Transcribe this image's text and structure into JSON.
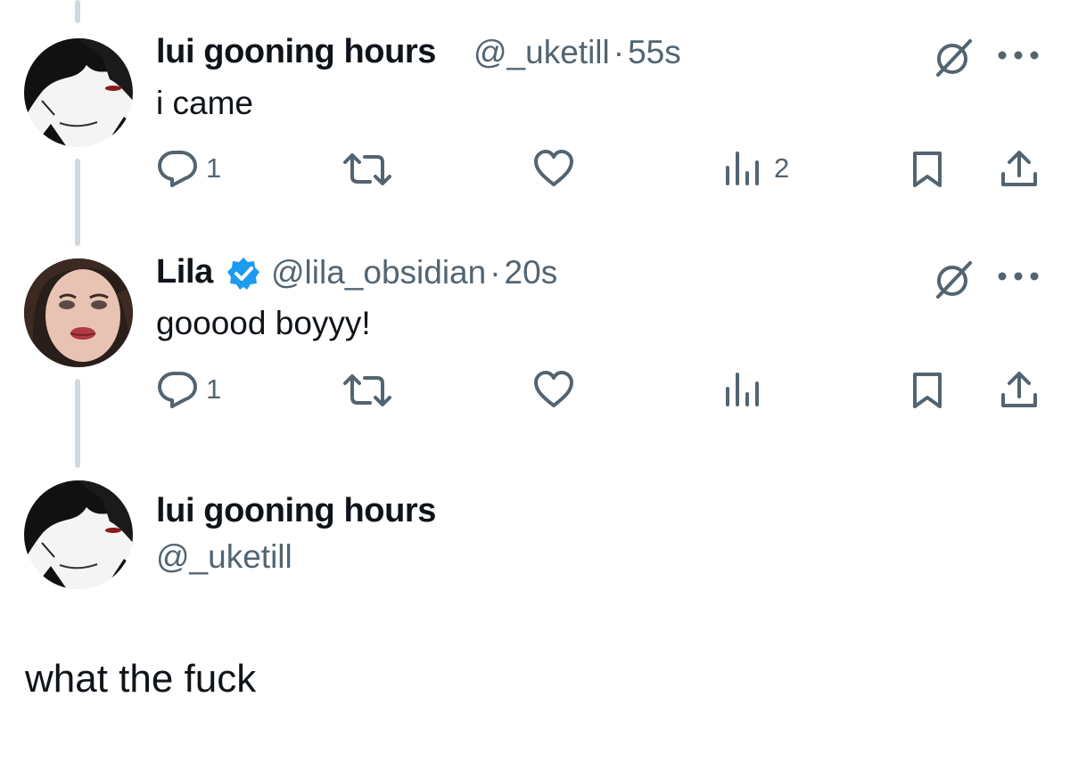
{
  "tweets": [
    {
      "display_name": "lui gooning hours",
      "handle": "@_uketill",
      "separator": "·",
      "time": "55s",
      "text": "i came",
      "reply_count": "1",
      "views_count": "2",
      "verified": false
    },
    {
      "display_name": "Lila",
      "handle": "@lila_obsidian",
      "separator": "·",
      "time": "20s",
      "text": "gooood boyyy!",
      "reply_count": "1",
      "views_count": "",
      "verified": true
    }
  ],
  "main_post": {
    "display_name": "lui gooning hours",
    "handle": "@_uketill",
    "text": "what the fuck"
  },
  "colors": {
    "text_primary": "#0f1419",
    "text_secondary": "#536471",
    "thread_line": "#cfd9de",
    "verified_blue": "#1d9bf0"
  },
  "icons": [
    "grok-icon",
    "more-icon",
    "reply-icon",
    "retweet-icon",
    "like-icon",
    "views-icon",
    "bookmark-icon",
    "share-icon",
    "verified-badge-icon"
  ]
}
